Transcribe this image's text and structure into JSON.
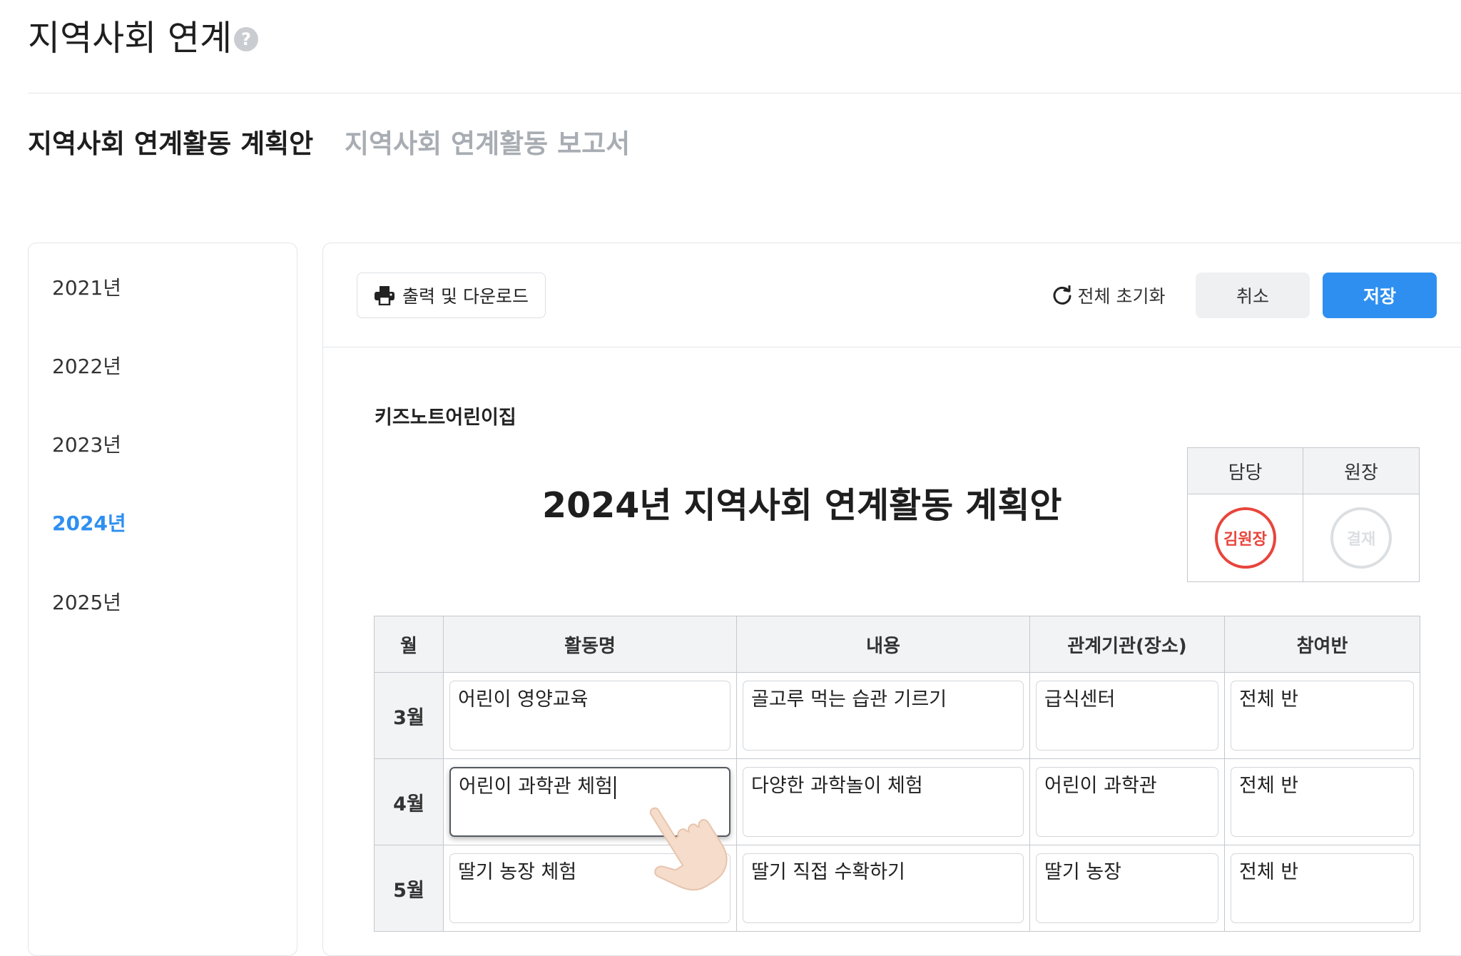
{
  "header": {
    "title": "지역사회 연계",
    "help_icon": "question-circle-icon"
  },
  "tabs": [
    {
      "label": "지역사회 연계활동 계획안",
      "active": true
    },
    {
      "label": "지역사회 연계활동 보고서",
      "active": false
    }
  ],
  "sidebar": {
    "years": [
      {
        "label": "2021년",
        "active": false
      },
      {
        "label": "2022년",
        "active": false
      },
      {
        "label": "2023년",
        "active": false
      },
      {
        "label": "2024년",
        "active": true
      },
      {
        "label": "2025년",
        "active": false
      }
    ]
  },
  "toolbar": {
    "print_label": "출력 및 다운로드",
    "print_icon": "printer-icon",
    "reset_label": "전체 초기화",
    "reset_icon": "refresh-icon",
    "cancel_label": "취소",
    "save_label": "저장"
  },
  "document": {
    "school_name": "키즈노트어린이집",
    "title": "2024년 지역사회 연계활동 계획안",
    "approval": {
      "headers": [
        "담당",
        "원장"
      ],
      "signed_stamp": "김원장",
      "pending_stamp": "결재"
    },
    "table": {
      "headers": [
        "월",
        "활동명",
        "내용",
        "관계기관(장소)",
        "참여반"
      ],
      "rows": [
        {
          "month": "3월",
          "activity": "어린이 영양교육",
          "content": "골고루 먹는 습관 기르기",
          "place": "급식센터",
          "class": "전체 반"
        },
        {
          "month": "4월",
          "activity": "어린이 과학관 체험",
          "content": "다양한 과학놀이 체험",
          "place": "어린이 과학관",
          "class": "전체 반"
        },
        {
          "month": "5월",
          "activity": "딸기 농장 체험",
          "content": "딸기 직접 수확하기",
          "place": "딸기 농장",
          "class": "전체 반"
        }
      ]
    }
  },
  "colors": {
    "accent": "#2e8ff0",
    "stamp_red": "#e8453c",
    "muted_text": "#a8adb3"
  }
}
